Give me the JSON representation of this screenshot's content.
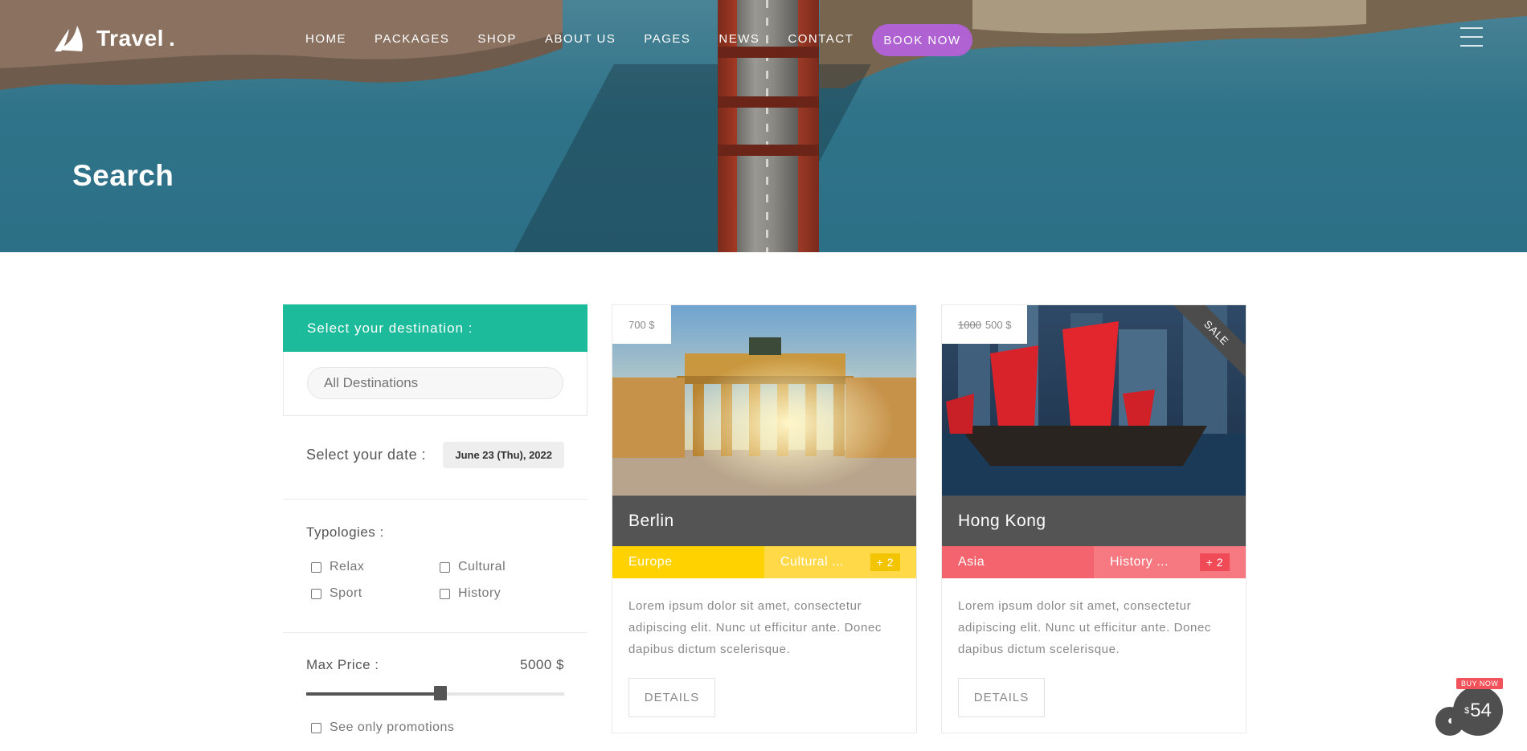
{
  "brand": {
    "name": "Travel",
    "dot": "."
  },
  "nav": {
    "items": [
      "HOME",
      "PACKAGES",
      "SHOP",
      "ABOUT US",
      "PAGES",
      "NEWS",
      "CONTACT"
    ],
    "book_label": "BOOK NOW"
  },
  "hero": {
    "title": "Search"
  },
  "sidebar": {
    "destination_header": "Select your destination :",
    "destination_placeholder": "All Destinations",
    "date_label": "Select your date :",
    "date_value": "June 23 (Thu), 2022",
    "typologies_label": "Typologies :",
    "typologies": [
      "Relax",
      "Cultural",
      "Sport",
      "History"
    ],
    "max_price_label": "Max Price :",
    "max_price_value": "5000 $",
    "max_price_fraction": 0.52,
    "promo_label": "See only promotions"
  },
  "cards": [
    {
      "price": "700 $",
      "old_price": "",
      "sale": "",
      "title": "Berlin",
      "region": "Europe",
      "category": "Cultural ...",
      "more": "+ 2",
      "region_color": "#ffd200",
      "category_color": "#ffd948",
      "more_color": "#f2c500",
      "description": "Lorem ipsum dolor sit amet, consectetur adipiscing elit. Nunc ut efficitur ante. Donec dapibus dictum scelerisque.",
      "details_label": "DETAILS"
    },
    {
      "price": "500 $",
      "old_price": "1000",
      "sale": "SALE",
      "title": "Hong Kong",
      "region": "Asia",
      "category": "History ...",
      "more": "+ 2",
      "region_color": "#f4646e",
      "category_color": "#f67880",
      "more_color": "#ef4a56",
      "description": "Lorem ipsum dolor sit amet, consectetur adipiscing elit. Nunc ut efficitur ante. Donec dapibus dictum scelerisque.",
      "details_label": "DETAILS"
    }
  ],
  "widget": {
    "buy_label": "BUY NOW",
    "currency": "$",
    "price": "54"
  },
  "colors": {
    "accent_green": "#1cbb9b",
    "book_purple": "#b062d2",
    "card_title_bg": "#545454"
  }
}
